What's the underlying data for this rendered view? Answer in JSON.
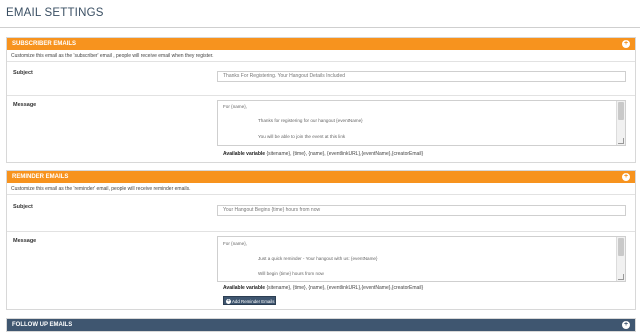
{
  "page": {
    "title": "EMAIL SETTINGS"
  },
  "subscriber": {
    "heading": "SUBSCRIBER EMAILS",
    "description": "Customize this email as the 'subscriber' email , people will receive email when they register.",
    "subject_label": "Subject",
    "subject_value": "Thanks For Registering. Your Hangout Details Included",
    "message_label": "Message",
    "message_lines": [
      "For {name},",
      "Thanks for registering for our hangout {eventName}",
      "You will be able to join the event at this link"
    ],
    "available_label": "Available variable",
    "available_vars": "{sitename}, {time}, {name}, {eventlinkURL},{eventName},{creatorEmail}"
  },
  "reminder": {
    "heading": "REMINDER EMAILS",
    "description": "Customize this email as the 'reminder' email, people will receive reminder emails.",
    "subject_label": "Subject",
    "subject_value": "Your Hangout Begins {time} hours from now",
    "message_label": "Message",
    "message_lines": [
      "For {name},",
      "Just a quick reminder - Your hangout with us: {eventName}",
      "Will begin {time} hours from now"
    ],
    "available_label": "Available variable",
    "available_vars": "{sitename}, {time}, {name}, {eventlinkURL},{eventName},{creatorEmail}",
    "add_button": "Add Reminder Emails"
  },
  "followup": {
    "heading": "FOLLOW UP EMAILS"
  },
  "icons": {
    "toggle": "plus-circle-icon",
    "add": "plus-circle-icon",
    "scroll": "scrollbar",
    "resize": "resize-grip-icon"
  },
  "colors": {
    "orange": "#f7931e",
    "navy": "#3f5670"
  }
}
